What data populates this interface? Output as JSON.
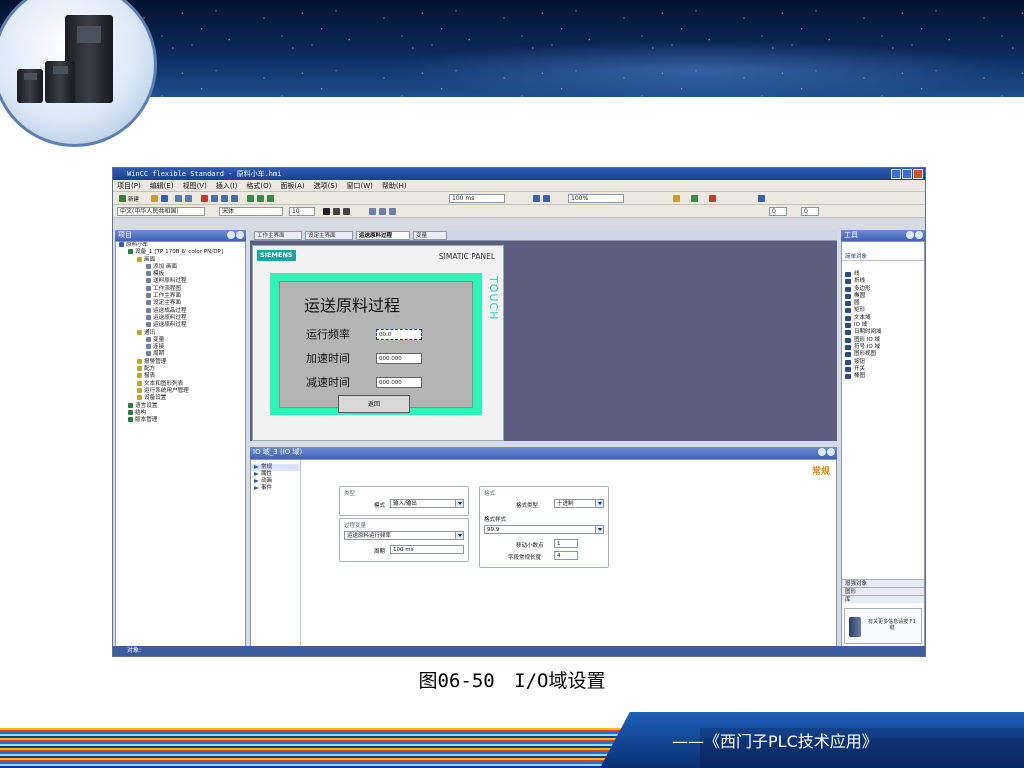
{
  "app": {
    "title": "WinCC flexible Standard - 原料小车.hmi",
    "menu": [
      "项目(P)",
      "编辑(E)",
      "视图(V)",
      "插入(I)",
      "格式(O)",
      "面板(A)",
      "选项(S)",
      "窗口(W)",
      "帮助(H)"
    ],
    "toolbar": {
      "new_label": "新建",
      "zoom1": "100 ms",
      "zoom2": "100%",
      "font_field": "宋体",
      "size_field": "10",
      "lang_field": "中文(中华人民共和国)",
      "pos_x": "0",
      "pos_y": "0"
    },
    "project_pane": {
      "title": "项目",
      "tree": [
        {
          "label": "原料小车",
          "indent": 0
        },
        {
          "label": "设备_1 [TP 170B 6' color PN/DP]",
          "indent": 1
        },
        {
          "label": "画面",
          "indent": 2
        },
        {
          "label": "添加 画面",
          "indent": 3
        },
        {
          "label": "模板",
          "indent": 3
        },
        {
          "label": "送料原料过程",
          "indent": 3
        },
        {
          "label": "工作流程图",
          "indent": 3
        },
        {
          "label": "工作主界面",
          "indent": 3
        },
        {
          "label": "设定主界面",
          "indent": 3
        },
        {
          "label": "运送成品过程",
          "indent": 3
        },
        {
          "label": "运送原料过程",
          "indent": 3
        },
        {
          "label": "运送原料过程",
          "indent": 3
        },
        {
          "label": "通讯",
          "indent": 2
        },
        {
          "label": "变量",
          "indent": 3
        },
        {
          "label": "连接",
          "indent": 3
        },
        {
          "label": "周期",
          "indent": 3
        },
        {
          "label": "报警管理",
          "indent": 2
        },
        {
          "label": "配方",
          "indent": 2
        },
        {
          "label": "报表",
          "indent": 2
        },
        {
          "label": "文本和图形列表",
          "indent": 2
        },
        {
          "label": "运行系统用户管理",
          "indent": 2
        },
        {
          "label": "设备设置",
          "indent": 2
        },
        {
          "label": "语言设置",
          "indent": 1
        },
        {
          "label": "结构",
          "indent": 1
        },
        {
          "label": "版本管理",
          "indent": 1
        }
      ]
    },
    "tabs": [
      {
        "label": "工作主界面",
        "active": false
      },
      {
        "label": "设定主界面",
        "active": false
      },
      {
        "label": "运送原料过程",
        "active": true
      },
      {
        "label": "变量",
        "active": false
      }
    ],
    "hmi": {
      "brand": "SIEMENS",
      "model": "SIMATIC PANEL",
      "touch": "TOUCH",
      "screen_title": "运送原料过程",
      "rows": [
        {
          "label": "运行频率",
          "value": "00.0"
        },
        {
          "label": "加速时间",
          "value": "000.000"
        },
        {
          "label": "减速时间",
          "value": "000.000"
        }
      ],
      "button": "返回"
    },
    "properties": {
      "header": "IO 域_3 (IO 域)",
      "nav": [
        "常规",
        "属性",
        "动画",
        "事件"
      ],
      "general_tag": "常规",
      "type_group": "类型",
      "mode_label": "模式",
      "mode_value": "输入/输出",
      "process_group": "过程变量",
      "process_value": "运送原料运行频率",
      "cycle_label": "周期",
      "cycle_value": "100 ms",
      "format_group": "格式",
      "format_type_label": "格式类型",
      "format_type_value": "十进制",
      "pattern_label": "格式样式",
      "pattern_value": "99.9",
      "decimals_label": "移动小数点",
      "decimals_value": "1",
      "length_label": "字段常规长度",
      "length_value": "4"
    },
    "tools_pane": {
      "title": "工具",
      "section": "简单对象",
      "items": [
        "线",
        "折线",
        "多边形",
        "椭圆",
        "圆",
        "矩形",
        "文本域",
        "IO 域",
        "日期时间域",
        "图形 IO 域",
        "符号 IO 域",
        "图形视图",
        "按钮",
        "开关",
        "棒图"
      ],
      "sub_sections": [
        "增强对象",
        "图形",
        "库"
      ],
      "help_text": "有关更多信息请按 F1 键"
    },
    "status": "对象:"
  },
  "caption": {
    "figure": "图06-50",
    "text": "I/O域设置"
  },
  "footer": {
    "title": "——《西门子PLC技术应用》"
  }
}
